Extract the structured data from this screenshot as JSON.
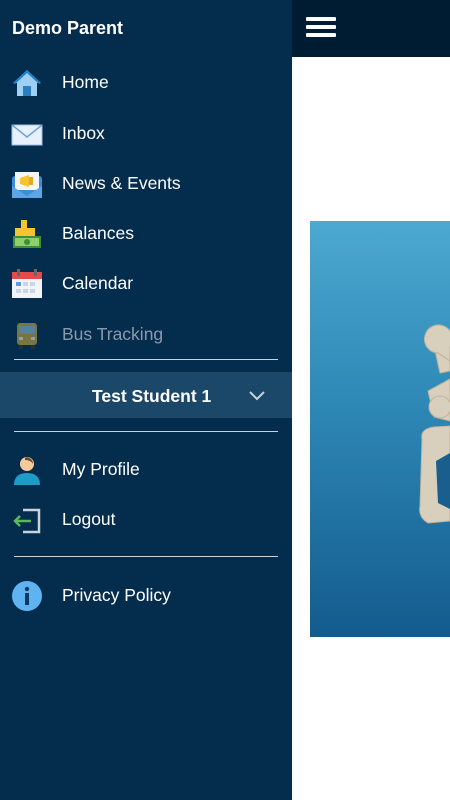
{
  "drawer": {
    "user_name": "Demo Parent",
    "items": [
      {
        "label": "Home",
        "icon": "home-icon"
      },
      {
        "label": "Inbox",
        "icon": "mail-icon"
      },
      {
        "label": "News & Events",
        "icon": "megaphone-icon"
      },
      {
        "label": "Balances",
        "icon": "money-icon"
      },
      {
        "label": "Calendar",
        "icon": "calendar-icon"
      },
      {
        "label": "Bus Tracking",
        "icon": "bus-icon",
        "disabled": true
      }
    ],
    "student_selector": {
      "label": "Test Student 1",
      "icon": "chevron-down-icon"
    },
    "account_items": [
      {
        "label": "My Profile",
        "icon": "user-icon"
      },
      {
        "label": "Logout",
        "icon": "logout-icon"
      }
    ],
    "footer_items": [
      {
        "label": "Privacy Policy",
        "icon": "info-icon"
      }
    ]
  },
  "header": {
    "menu_icon": "hamburger-icon"
  },
  "colors": {
    "drawer_bg": "#042c4d",
    "selector_bg": "#1b4869",
    "topbar_bg": "#001c33",
    "disabled_text": "#8a9aab"
  }
}
